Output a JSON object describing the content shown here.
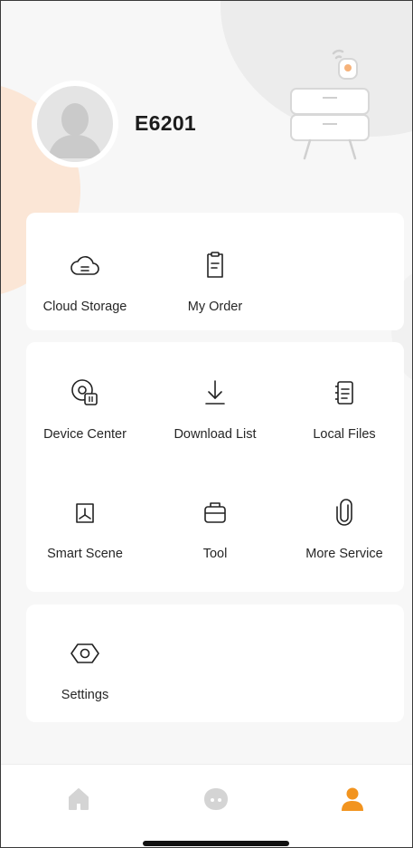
{
  "profile": {
    "username": "E6201"
  },
  "cards": {
    "storage": {
      "cloud_storage": "Cloud Storage",
      "my_order": "My Order"
    },
    "services": {
      "device_center": "Device Center",
      "download_list": "Download List",
      "local_files": "Local Files",
      "smart_scene": "Smart Scene",
      "tool": "Tool",
      "more_service": "More Service"
    },
    "settings": {
      "settings": "Settings"
    }
  },
  "tabbar": {
    "tabs": [
      {
        "icon": "home-icon",
        "active": false
      },
      {
        "icon": "chat-icon",
        "active": false
      },
      {
        "icon": "user-icon",
        "active": true
      }
    ],
    "active_color": "#f2941f",
    "inactive_color": "#d4d4d4"
  },
  "colors": {
    "accent": "#f2941f",
    "background": "#f7f7f7",
    "card": "#ffffff",
    "text": "#262626"
  }
}
